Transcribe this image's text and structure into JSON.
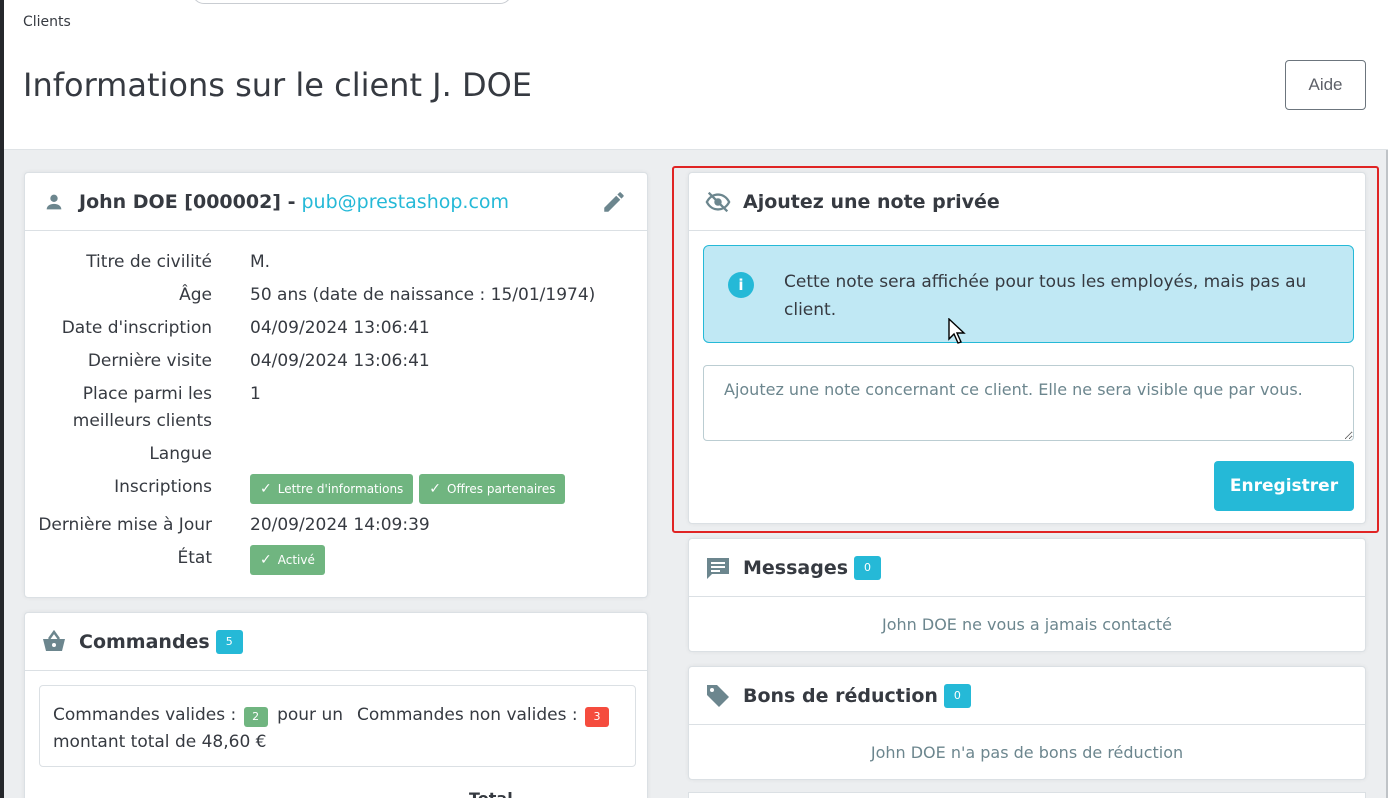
{
  "header": {
    "breadcrumb": "Clients",
    "title": "Informations sur le client J. DOE",
    "help_label": "Aide"
  },
  "customer": {
    "name": "John DOE [000002] -",
    "email": "pub@prestashop.com",
    "rows": [
      {
        "label": "Titre de civilité",
        "value": "M."
      },
      {
        "label": "Âge",
        "value": "50 ans (date de naissance : 15/01/1974)"
      },
      {
        "label": "Date d'inscription",
        "value": "04/09/2024 13:06:41"
      },
      {
        "label": "Dernière visite",
        "value": "04/09/2024 13:06:41"
      },
      {
        "label_line1": "Place parmi les",
        "label_line2": "meilleurs clients",
        "value": "1"
      },
      {
        "label": "Langue",
        "value": ""
      },
      {
        "label": "Inscriptions",
        "pills": [
          "Lettre d'informations",
          "Offres partenaires"
        ]
      },
      {
        "label": "Dernière mise à Jour",
        "value": "20/09/2024 14:09:39"
      },
      {
        "label": "État",
        "pill": "Activé"
      }
    ]
  },
  "orders": {
    "title": "Commandes",
    "count": "5",
    "valid_prefix": "Commandes valides :",
    "valid_count": "2",
    "valid_suffix": "pour un montant total de 48,60 €",
    "invalid_label": "Commandes non valides :",
    "invalid_count": "3",
    "partial_text": "Total"
  },
  "note": {
    "title": "Ajoutez une note privée",
    "alert": "Cette note sera affichée pour tous les employés, mais pas au client.",
    "placeholder": "Ajoutez une note concernant ce client. Elle ne sera visible que par vous.",
    "save_label": "Enregistrer"
  },
  "messages": {
    "title": "Messages",
    "count": "0",
    "empty": "John DOE ne vous a jamais contacté"
  },
  "vouchers": {
    "title": "Bons de réduction",
    "count": "0",
    "empty": "John DOE n'a pas de bons de réduction"
  },
  "colors": {
    "accent": "#25b9d7",
    "success": "#70b580",
    "danger": "#f54c3e",
    "highlight": "#e02424"
  }
}
